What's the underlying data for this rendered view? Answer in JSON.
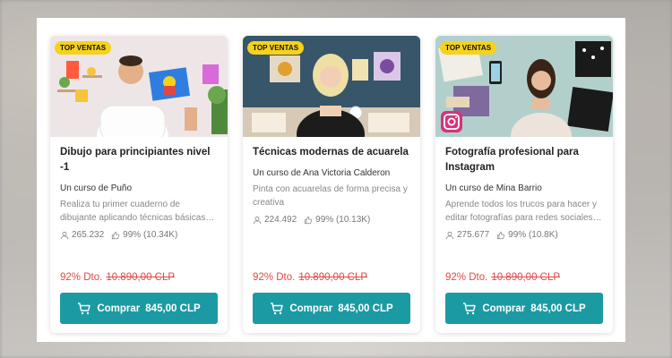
{
  "courses": [
    {
      "badge": "TOP VENTAS",
      "title": "Dibujo para principiantes nivel -1",
      "author": "Un curso de Puño",
      "description": "Realiza tu primer cuaderno de dibujante aplicando técnicas básicas…",
      "students": "265.232",
      "rating": "99% (10.34K)",
      "discount": "92% Dto.",
      "old_price": "10.890,00 CLP",
      "buy_label": "Comprar",
      "price": "845,00 CLP"
    },
    {
      "badge": "TOP VENTAS",
      "title": "Técnicas modernas de acuarela",
      "author": "Un curso de Ana Victoria Calderon",
      "description": "Pinta con acuarelas de forma precisa y creativa",
      "students": "224.492",
      "rating": "99% (10.13K)",
      "discount": "92% Dto.",
      "old_price": "10.890,00 CLP",
      "buy_label": "Comprar",
      "price": "845,00 CLP"
    },
    {
      "badge": "TOP VENTAS",
      "title": "Fotografía profesional para Instagram",
      "author": "Un curso de Mina Barrio",
      "description": "Aprende todos los trucos para hacer y editar fotografías para redes sociales…",
      "students": "275.677",
      "rating": "99% (10.8K)",
      "discount": "92% Dto.",
      "old_price": "10.890,00 CLP",
      "buy_label": "Comprar",
      "price": "845,00 CLP"
    }
  ],
  "colors": {
    "accent": "#1c9aa4",
    "badge": "#f6d21c",
    "discount": "#e04848"
  },
  "icons": [
    "user-icon",
    "thumbs-up-icon",
    "cart-icon",
    "instagram-icon"
  ]
}
